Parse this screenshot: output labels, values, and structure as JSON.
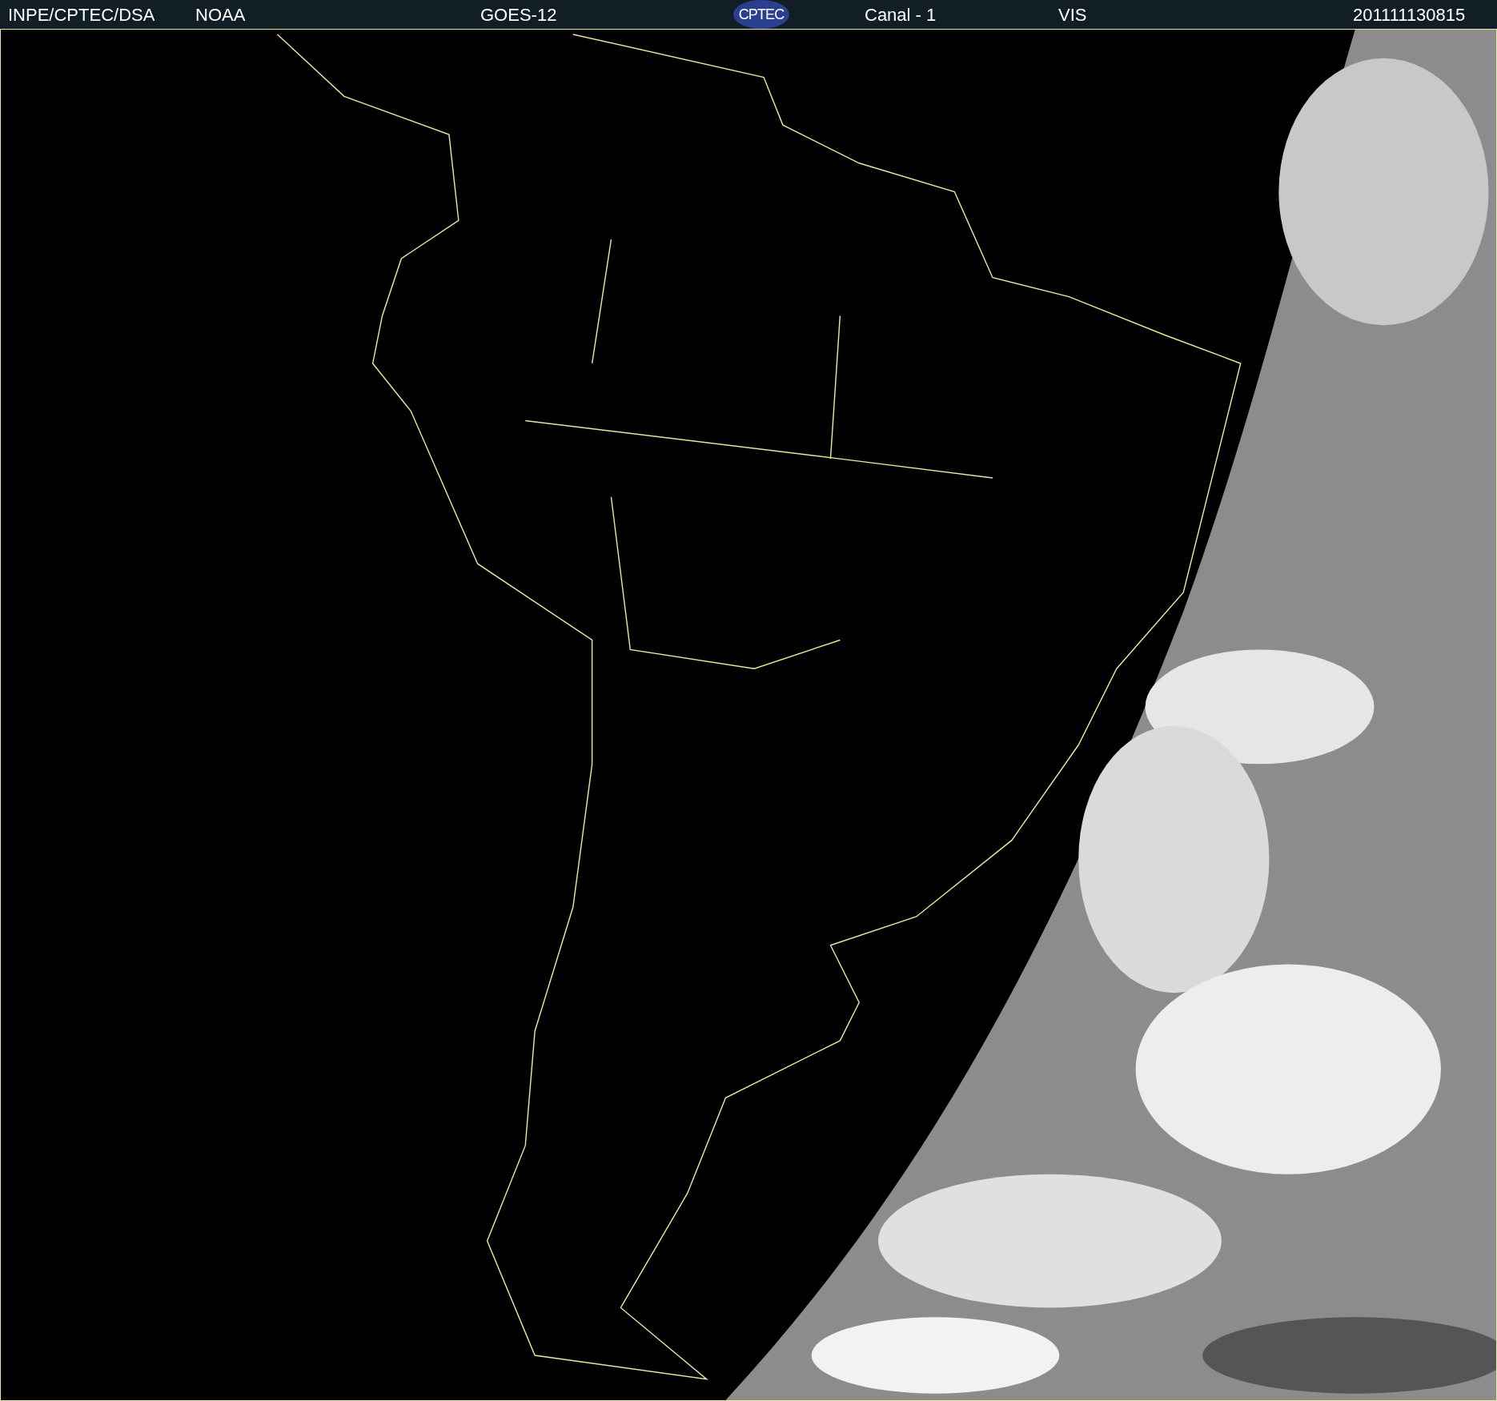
{
  "header": {
    "items": [
      {
        "kind": "text",
        "text": "INPE/CPTEC/DSA"
      },
      {
        "kind": "text",
        "text": "NOAA"
      },
      {
        "kind": "text",
        "text": "GOES-12"
      },
      {
        "kind": "logo",
        "text": "CPTEC"
      },
      {
        "kind": "text",
        "text": "Canal - 1"
      },
      {
        "kind": "text",
        "text": "VIS"
      },
      {
        "kind": "text",
        "text": "201111130815"
      }
    ]
  }
}
